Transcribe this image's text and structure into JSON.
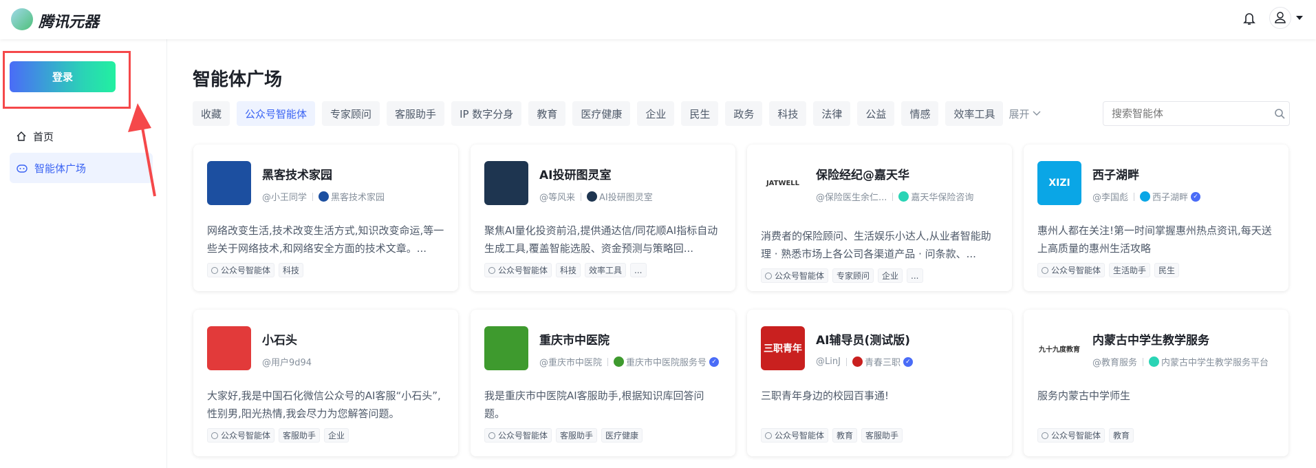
{
  "header": {
    "logo_text": "腾讯元器",
    "icons": [
      "bell-icon",
      "user-icon",
      "caret-down-icon"
    ]
  },
  "sidebar": {
    "login_label": "登录",
    "items": [
      {
        "label": "首页",
        "icon": "home-icon"
      },
      {
        "label": "智能体广场",
        "icon": "robot-icon",
        "active": true
      }
    ]
  },
  "main": {
    "title": "智能体广场",
    "tabs": [
      "收藏",
      "公众号智能体",
      "专家顾问",
      "客服助手",
      "IP 数字分身",
      "教育",
      "医疗健康",
      "企业",
      "民生",
      "政务",
      "科技",
      "法律",
      "公益",
      "情感",
      "效率工具"
    ],
    "active_tab": "公众号智能体",
    "expand_label": "展开",
    "search_placeholder": "搜索智能体",
    "cards": [
      {
        "name": "黑客技术家园",
        "author": "@小王同学",
        "account": "黑客技术家园",
        "verified": false,
        "desc": "网络改变生活,技术改变生活方式,知识改变命运,等一些关于网络技术,和网络安全方面的技术文章。...",
        "tags": [
          "公众号智能体",
          "科技"
        ],
        "avatar_color": "#1c4fa0"
      },
      {
        "name": "AI投研图灵室",
        "author": "@等风来",
        "account": "AI投研图灵室",
        "verified": false,
        "desc": "聚焦AI量化投资前沿,提供通达信/同花顺AI指标自动生成工具,覆盖智能选股、资金预测与策略回...",
        "tags": [
          "公众号智能体",
          "科技",
          "效率工具",
          "..."
        ],
        "avatar_color": "#1e3550"
      },
      {
        "name": "保险经纪@嘉天华",
        "author": "@保险医生余仁...",
        "account": "嘉天华保险咨询",
        "verified": false,
        "desc": "消费者的保险顾问、生活娱乐小达人,从业者智能助理 · 熟悉市场上各公司各渠道产品 · 问条款、...",
        "tags": [
          "公众号智能体",
          "专家顾问",
          "企业",
          "..."
        ],
        "avatar_color": "#ffffff",
        "avatar_text": "JATWELL"
      },
      {
        "name": "西子湖畔",
        "author": "@李国彪",
        "account": "西子湖畔",
        "verified": true,
        "desc": "惠州人都在关注!第一时间掌握惠州热点资讯,每天送上高质量的惠州生活攻略",
        "tags": [
          "公众号智能体",
          "生活助手",
          "民生"
        ],
        "avatar_color": "#0aa6e6",
        "avatar_text": "XIZI"
      },
      {
        "name": "小石头",
        "author": "@用户9d94",
        "account": "",
        "verified": false,
        "desc": "大家好,我是中国石化微信公众号的AI客服“小石头”,性别男,阳光热情,我会尽力为您解答问题。",
        "tags": [
          "公众号智能体",
          "客服助手",
          "企业"
        ],
        "avatar_color": "#e23a3a"
      },
      {
        "name": "重庆市中医院",
        "author": "@重庆市中医院",
        "account": "重庆市中医院服务号",
        "verified": true,
        "desc": "我是重庆市中医院AI客服助手,根据知识库回答问题。",
        "tags": [
          "公众号智能体",
          "客服助手",
          "医疗健康"
        ],
        "avatar_color": "#3e9a2e"
      },
      {
        "name": "AI辅导员(测试版)",
        "author": "@LinJ",
        "account": "青春三职",
        "verified": true,
        "desc": "三职青年身边的校园百事通!",
        "tags": [
          "公众号智能体",
          "教育",
          "客服助手"
        ],
        "avatar_color": "#c9201f",
        "avatar_text": "三职青年"
      },
      {
        "name": "内蒙古中学生教学服务",
        "author": "@教育服务",
        "account": "内蒙古中学生教学服务平台",
        "verified": false,
        "desc": "服务内蒙古中学师生",
        "tags": [
          "公众号智能体",
          "教育"
        ],
        "avatar_color": "#ffffff",
        "avatar_text": "九十九度教育"
      }
    ]
  },
  "colors": {
    "accent": "#3a63f3",
    "annotation_red": "#f5484a"
  }
}
